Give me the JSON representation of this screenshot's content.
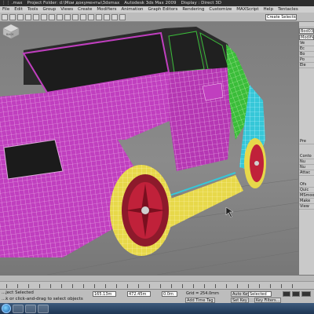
{
  "window": {
    "title_parts": [
      "⋮⋮ .max",
      "Project Folder: d:\\Мои документы\\3dsmax",
      "Autodesk 3ds Max  2009",
      "Display : Direct 3D"
    ]
  },
  "menu": {
    "items": [
      "File",
      "Edit",
      "Tools",
      "Group",
      "Views",
      "Create",
      "Modifiers",
      "Animation",
      "Graph Editors",
      "Rendering",
      "Customize",
      "MAXScript",
      "Help",
      "Tentacles"
    ]
  },
  "toolbar": {
    "selection_set_placeholder": "Create Selection Set"
  },
  "viewport": {
    "background_color": "#808080",
    "viewcube_label": "BACK"
  },
  "command_panel": {
    "object_name": "Bod03",
    "modifier_list_label": "Modifier L",
    "items": [
      "Ve",
      "Ec",
      "Bo",
      "Po",
      "Ele"
    ],
    "labels": [
      "Pre",
      "Conto",
      "Nu",
      "Nu",
      "Attac",
      "Ofs",
      "Quic",
      "MSmoo",
      "Make",
      "View"
    ]
  },
  "status": {
    "selected_text": "...ject Selected",
    "prompt_text": "...k or click-and-drag to select objects",
    "x_value": "165.13m",
    "y_value": "472.45m",
    "z_value": "0.0m",
    "grid_label": "Grid = 254.0mm",
    "auto_key_label": "Auto Key",
    "set_key_label": "Set Key",
    "selected_option": "Selected",
    "key_filters_label": "Key Filters...",
    "add_time_tag_label": "Add Time Tag"
  },
  "accent_colors": {
    "wire_magenta": "#c03fbf",
    "wire_green": "#3bbd3a",
    "wire_cyan": "#36c7d8",
    "wire_yellow": "#e7d84a",
    "wheel_red": "#c0213a"
  },
  "taskbar": {
    "start_icon": "windows-orb-icon"
  }
}
